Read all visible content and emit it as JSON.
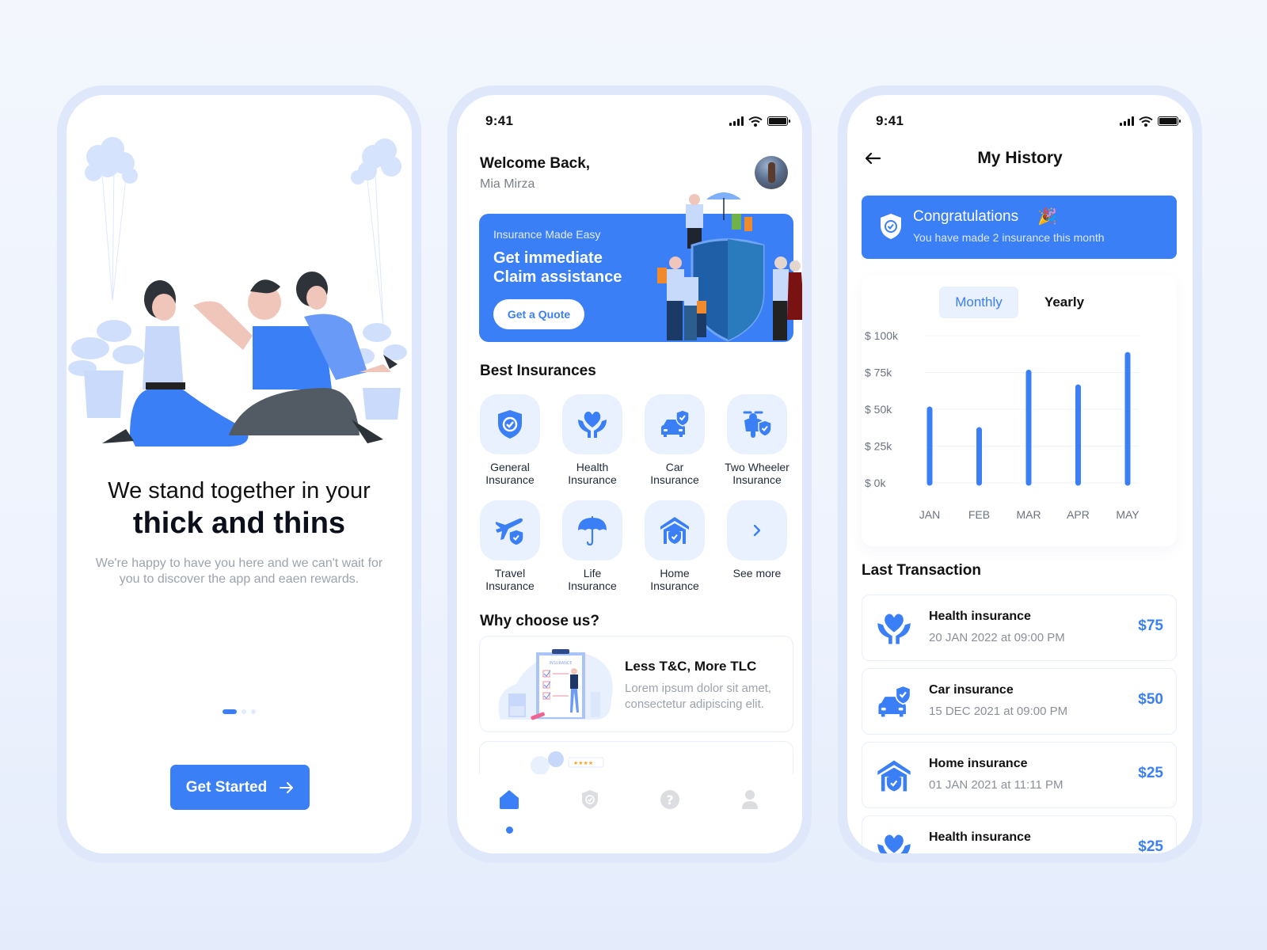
{
  "colors": {
    "accent": "#3b7ff6",
    "tile_bg": "#e9f1ff",
    "muted_text": "#9ca3af",
    "frame": "#dfe8fb"
  },
  "onboarding": {
    "title_line1": "We stand together in your",
    "title_line2": "thick and thins",
    "subtitle": "We're happy to have you here and we can't wait for you to discover the app and eaen rewards.",
    "pager": {
      "total": 3,
      "active": 1
    },
    "cta_label": "Get Started",
    "cta_icon": "arrow-right-icon"
  },
  "home": {
    "status_time": "9:41",
    "greeting": "Welcome Back,",
    "user_name": "Mia Mirza",
    "banner": {
      "kicker": "Insurance Made Easy",
      "headline": "Get immediate Claim assistance",
      "button_label": "Get a Quote"
    },
    "best_title": "Best Insurances",
    "insurances": [
      {
        "label": "General\nInsurance",
        "icon": "shield-check-icon"
      },
      {
        "label": "Health\nInsurance",
        "icon": "heart-hands-icon"
      },
      {
        "label": "Car\nInsurance",
        "icon": "car-shield-icon"
      },
      {
        "label": "Two Wheeler\nInsurance",
        "icon": "scooter-shield-icon"
      },
      {
        "label": "Travel\nInsurance",
        "icon": "plane-shield-icon"
      },
      {
        "label": "Life\nInsurance",
        "icon": "umbrella-icon"
      },
      {
        "label": "Home\nInsurance",
        "icon": "home-shield-icon"
      },
      {
        "label": "See more",
        "icon": "chevron-right-icon"
      }
    ],
    "why_title": "Why choose us?",
    "why_cards": [
      {
        "title": "Less T&C, More TLC",
        "desc": "Lorem ipsum dolor sit amet, consectetur adipiscing elit."
      }
    ],
    "tabs": [
      {
        "name": "home",
        "icon": "home-icon",
        "active": true
      },
      {
        "name": "policies",
        "icon": "shield-icon",
        "active": false
      },
      {
        "name": "help",
        "icon": "help-icon",
        "active": false
      },
      {
        "name": "profile",
        "icon": "user-icon",
        "active": false
      }
    ]
  },
  "history": {
    "status_time": "9:41",
    "title": "My History",
    "congrats_title": "Congratulations",
    "congrats_emoji": "🎉",
    "congrats_sub": "You have made 2 insurance this month",
    "toggle": {
      "monthly": "Monthly",
      "yearly": "Yearly",
      "selected": "Monthly"
    },
    "last_title": "Last Transaction",
    "transactions": [
      {
        "name": "Health insurance",
        "date": "20 JAN 2022 at 09:00 PM",
        "amount": "$75",
        "icon": "heart-hands-icon"
      },
      {
        "name": "Car insurance",
        "date": "15 DEC 2021 at 09:00 PM",
        "amount": "$50",
        "icon": "car-shield-icon"
      },
      {
        "name": "Home insurance",
        "date": "01 JAN 2021 at 11:11 PM",
        "amount": "$25",
        "icon": "home-shield-icon"
      },
      {
        "name": "Health insurance",
        "date": "",
        "amount": "$25",
        "icon": "heart-hands-icon"
      }
    ]
  },
  "chart_data": {
    "type": "bar",
    "title": "",
    "categories": [
      "JAN",
      "FEB",
      "MAR",
      "APR",
      "MAY"
    ],
    "values": [
      50000,
      36000,
      75000,
      65000,
      87000
    ],
    "yticks": [
      0,
      25000,
      50000,
      75000,
      100000
    ],
    "ytick_labels": [
      "$ 0k",
      "$ 25k",
      "$ 50k",
      "$ 75k",
      "$ 100k"
    ],
    "ylim": [
      0,
      100000
    ],
    "xlabel": "",
    "ylabel": "",
    "grid": true,
    "legend": "none"
  }
}
